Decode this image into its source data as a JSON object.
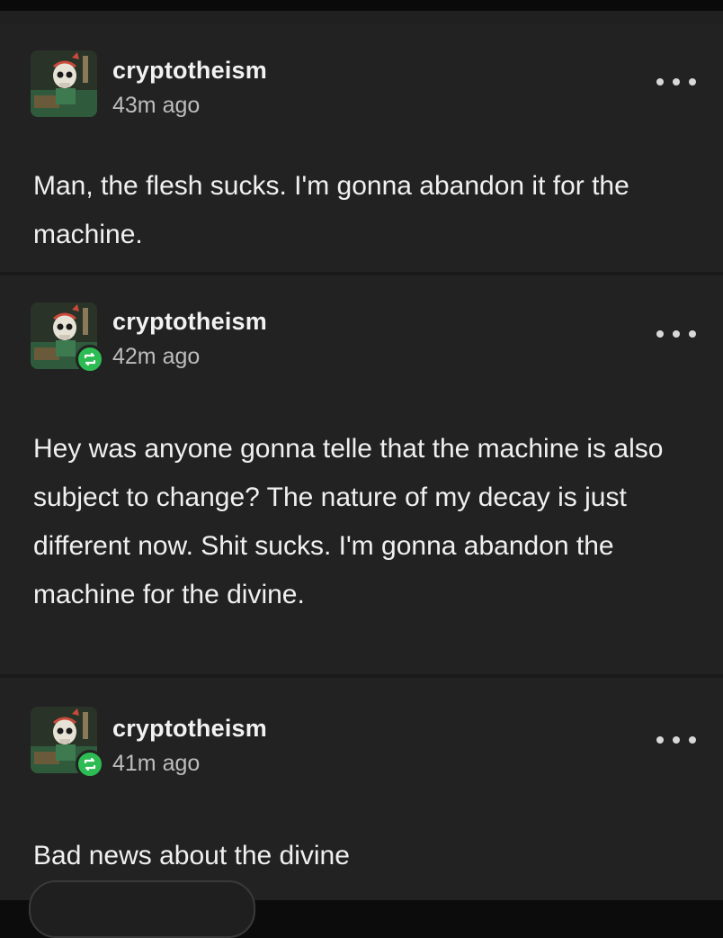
{
  "posts": [
    {
      "username": "cryptotheism",
      "time": "43m ago",
      "reblog_icon": "",
      "avatar_icon": "skull-avatar-icon",
      "more_icon": "more-dots-icon",
      "text": "Man, the flesh sucks. I'm gonna abandon it for the machine."
    },
    {
      "username": "cryptotheism",
      "time": "42m ago",
      "reblog_icon": "reblog-icon",
      "avatar_icon": "skull-avatar-icon",
      "more_icon": "more-dots-icon",
      "text": "Hey was anyone gonna telle that the machine is also subject to change? The nature of my decay is just different now. Shit sucks. I'm gonna abandon the machine for the divine."
    },
    {
      "username": "cryptotheism",
      "time": "41m ago",
      "reblog_icon": "reblog-icon",
      "avatar_icon": "skull-avatar-icon",
      "more_icon": "more-dots-icon",
      "text": "Bad news about the divine"
    }
  ],
  "colors": {
    "background": "#222222",
    "divider": "#1a1a1a",
    "reblog_green": "#2dbb53",
    "text": "#f0f0f0",
    "subtext": "#bdbdbd"
  }
}
